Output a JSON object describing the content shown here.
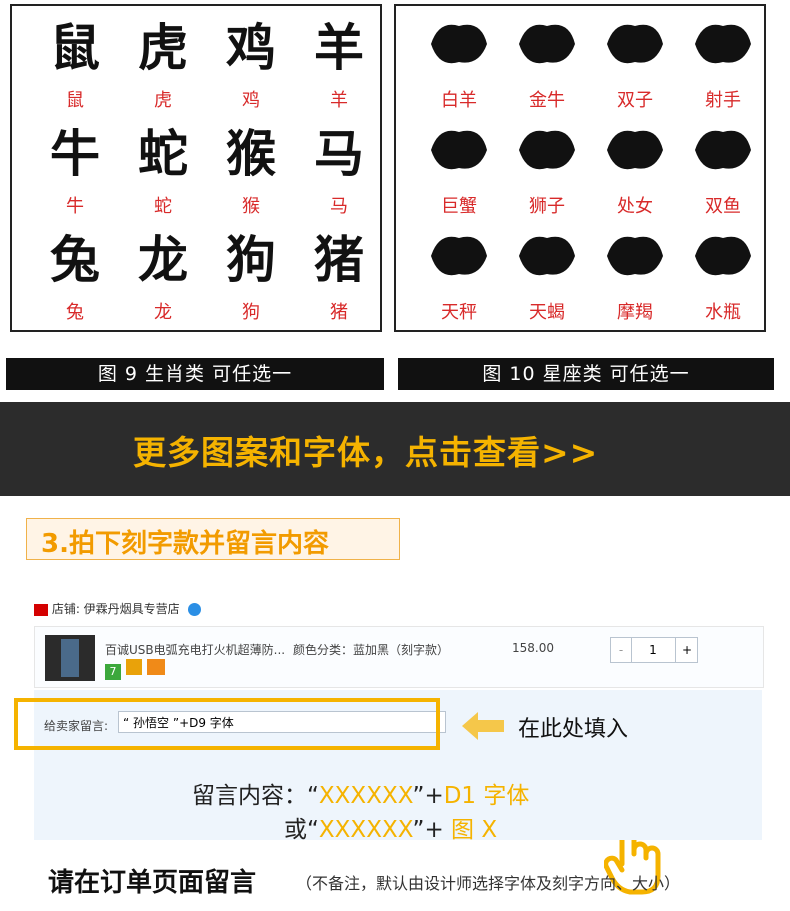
{
  "zodiac_panel": {
    "items": [
      {
        "glyph": "鼠",
        "label": "鼠"
      },
      {
        "glyph": "虎",
        "label": "虎"
      },
      {
        "glyph": "鸡",
        "label": "鸡"
      },
      {
        "glyph": "羊",
        "label": "羊"
      },
      {
        "glyph": "牛",
        "label": "牛"
      },
      {
        "glyph": "蛇",
        "label": "蛇"
      },
      {
        "glyph": "猴",
        "label": "猴"
      },
      {
        "glyph": "马",
        "label": "马"
      },
      {
        "glyph": "兔",
        "label": "兔"
      },
      {
        "glyph": "龙",
        "label": "龙"
      },
      {
        "glyph": "狗",
        "label": "狗"
      },
      {
        "glyph": "猪",
        "label": "猪"
      }
    ],
    "caption": "图 9    生肖类 可任选一"
  },
  "constellation_panel": {
    "items": [
      {
        "label": "白羊"
      },
      {
        "label": "金牛"
      },
      {
        "label": "双子"
      },
      {
        "label": "射手"
      },
      {
        "label": "巨蟹"
      },
      {
        "label": "狮子"
      },
      {
        "label": "处女"
      },
      {
        "label": "双鱼"
      },
      {
        "label": "天秤"
      },
      {
        "label": "天蝎"
      },
      {
        "label": "摩羯"
      },
      {
        "label": "水瓶"
      }
    ],
    "caption": "图 10    星座类 可任选一"
  },
  "banner": {
    "text": "更多图案和字体，点击查看>>",
    "icon": "pointing-hand-icon",
    "color": "#f5b300"
  },
  "section": {
    "title": "3.拍下刻字款并留言内容"
  },
  "order": {
    "shop_label": "店铺: 伊霖丹烟具专营店",
    "product_title": "百诚USB电弧充电打火机超薄防...",
    "variant": "颜色分类：蓝加黑（刻字款）",
    "price": "158.00",
    "quantity": "1",
    "qty_minus": "-",
    "qty_plus": "+",
    "message_label": "给卖家留言:",
    "message_value": "“ 孙悟空 ”+D9 字体",
    "fill_here": "在此处填入"
  },
  "notice": {
    "line1_prefix": "留言内容：“",
    "line1_x": "XXXXXX",
    "line1_mid": "”+",
    "line1_font": "D1 字体",
    "line2_prefix": "或“",
    "line2_x": "XXXXXX",
    "line2_mid": "”+ ",
    "line2_fig": "图 X"
  },
  "bottom": {
    "title": "请在订单页面留言",
    "subtitle": "（不备注，默认由设计师选择字体及刻字方向、大小）"
  }
}
